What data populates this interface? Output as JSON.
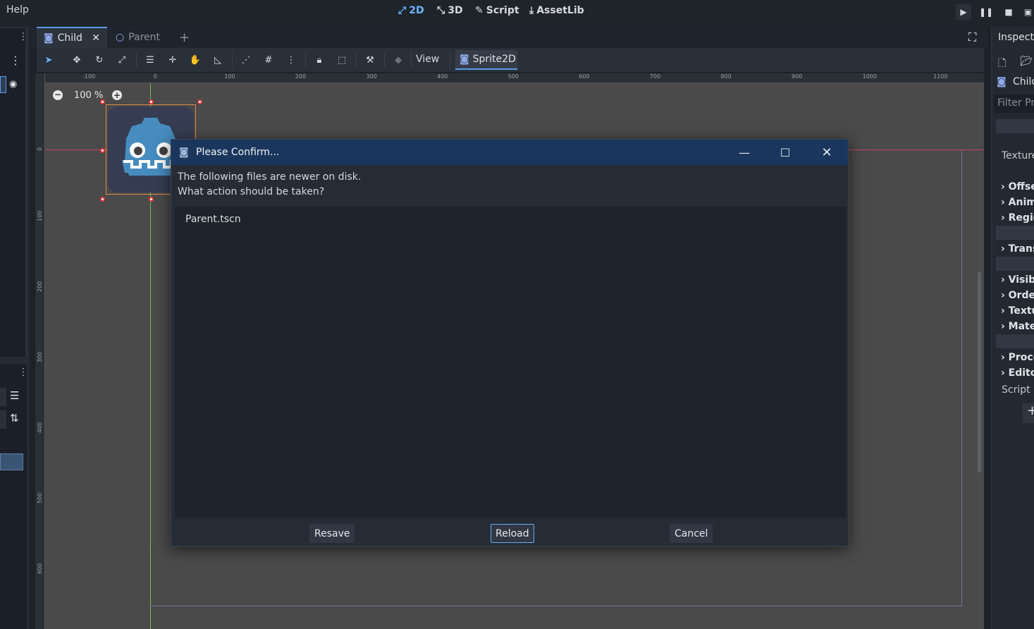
{
  "menu": {
    "help": "Help"
  },
  "workspaces": [
    {
      "label": "2D",
      "icon": "2d-icon"
    },
    {
      "label": "3D",
      "icon": "3d-icon"
    },
    {
      "label": "Script",
      "icon": "script-icon"
    },
    {
      "label": "AssetLib",
      "icon": "assetlib-icon"
    }
  ],
  "tabs": [
    {
      "label": "Child",
      "icon": "sprite-node-icon"
    },
    {
      "label": "Parent",
      "icon": "node2d-icon"
    }
  ],
  "toolbar": {
    "view": "View",
    "sprite2d": "Sprite2D"
  },
  "canvas": {
    "zoom": "100 %",
    "ruler_top": [
      "-100",
      "0",
      "100",
      "200",
      "300",
      "400",
      "500",
      "600",
      "700",
      "800",
      "900",
      "1000",
      "1100"
    ],
    "ruler_left": [
      "0",
      "100",
      "200",
      "300",
      "400",
      "500",
      "600"
    ]
  },
  "inspector": {
    "title": "Inspector",
    "node": "Child",
    "filter_placeholder": "Filter Properties",
    "texture_label": "Texture",
    "sections": [
      "Offset",
      "Animation",
      "Region",
      "Transform",
      "Visibility",
      "Ordering",
      "Texture",
      "Material",
      "Process",
      "Editor"
    ],
    "script_label": "Script"
  },
  "dialog": {
    "title": "Please Confirm...",
    "message_line1": "The following files are newer on disk.",
    "message_line2": "What action should be taken?",
    "files": [
      "Parent.tscn"
    ],
    "buttons": {
      "resave": "Resave",
      "reload": "Reload",
      "cancel": "Cancel"
    }
  },
  "colors": {
    "accent": "#5a9be8",
    "dialog_title": "#1a365d",
    "viewport": "#4a4a4a"
  }
}
